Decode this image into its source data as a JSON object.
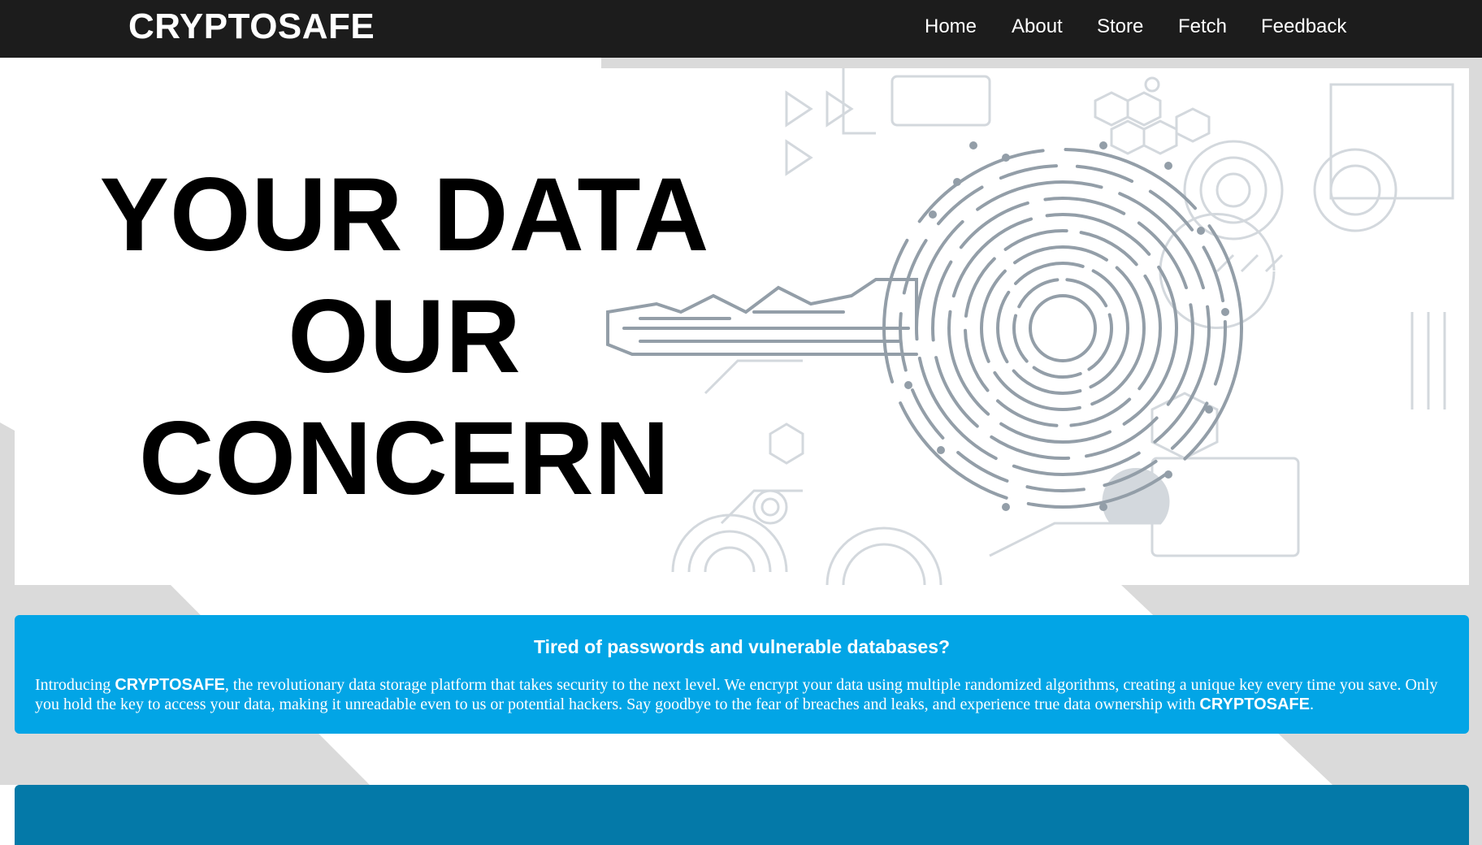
{
  "brand": "CRYPTOSAFE",
  "nav": {
    "items": [
      {
        "label": "Home"
      },
      {
        "label": "About"
      },
      {
        "label": "Store"
      },
      {
        "label": "Fetch"
      },
      {
        "label": "Feedback"
      }
    ]
  },
  "hero": {
    "title_line1": "YOUR DATA",
    "title_line2": "OUR",
    "title_line3": "CONCERN",
    "illustration": "digital-key-circuit-icon"
  },
  "intro": {
    "heading": "Tired of passwords and vulnerable databases?",
    "text_before": "Introducing ",
    "brand_1": "CRYPTOSAFE",
    "text_middle": ", the revolutionary data storage platform that takes security to the next level. We encrypt your data using multiple randomized algorithms, creating a unique key every time you save. Only you hold the key to access your data, making it unreadable even to us or potential hackers. Say goodbye to the fear of breaches and leaks, and experience true data ownership with ",
    "brand_2": "CRYPTOSAFE",
    "text_after": "."
  },
  "colors": {
    "navbar": "#1c1c1c",
    "intro_card": "#02a5e6",
    "lower_card": "#0479a8",
    "background_stripe": "#d9d9d9",
    "key_art": "#9aa4ad"
  }
}
